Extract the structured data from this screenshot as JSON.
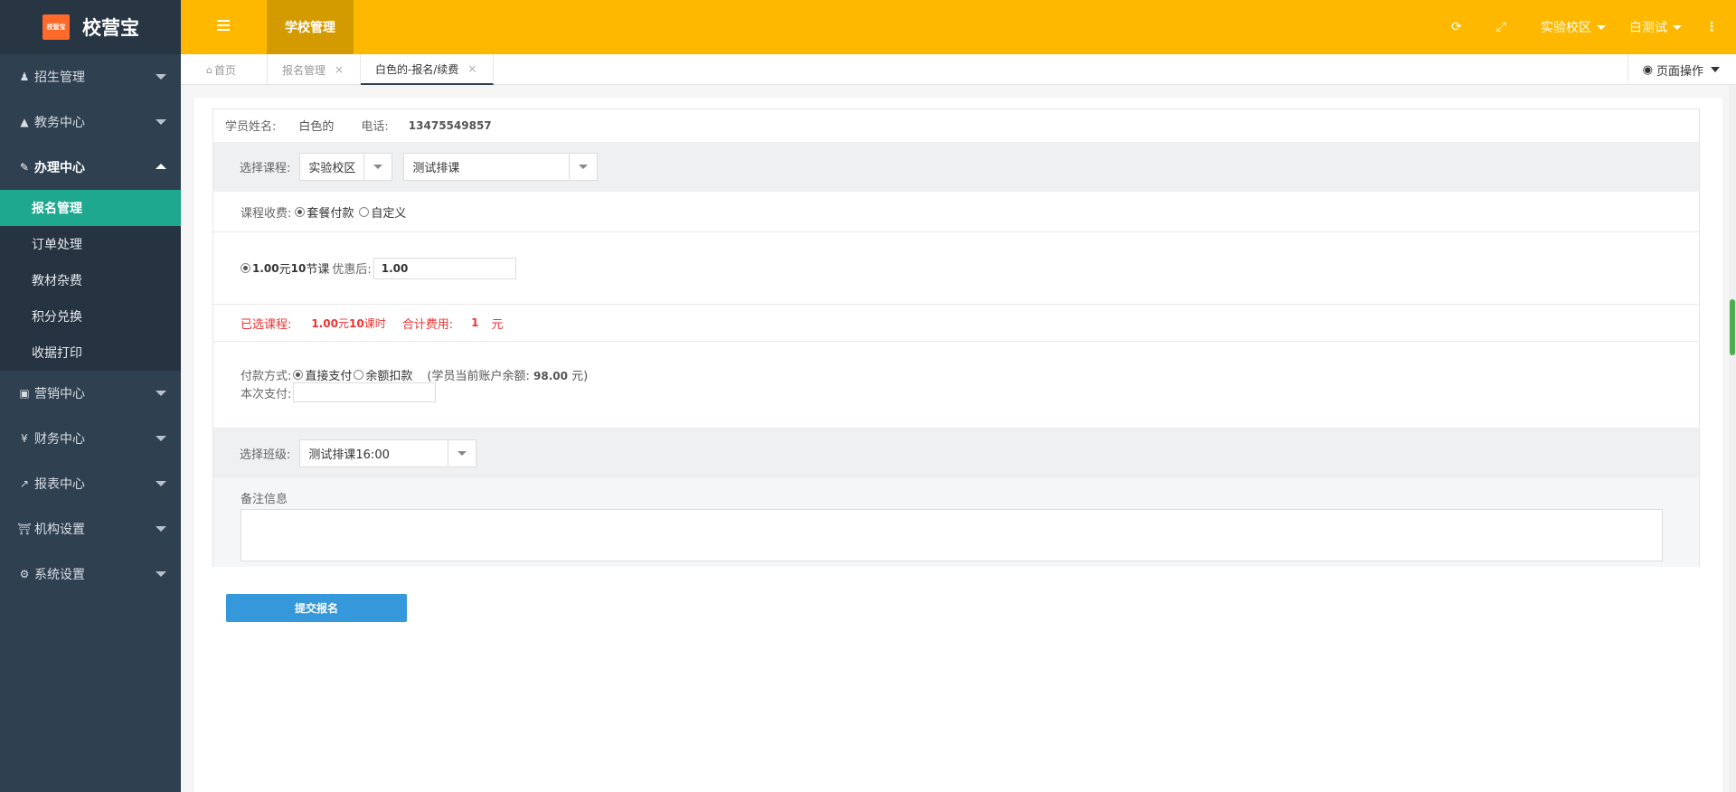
{
  "brand": {
    "logo_text": "校营宝",
    "name": "校营宝"
  },
  "sidebar": {
    "menus": [
      {
        "label": "招生管理",
        "icon": "user-icon"
      },
      {
        "label": "教务中心",
        "icon": "graduation-cap-icon"
      },
      {
        "label": "办理中心",
        "icon": "edit-icon"
      },
      {
        "label": "营销中心",
        "icon": "laptop-icon"
      },
      {
        "label": "财务中心",
        "icon": "yen-icon"
      },
      {
        "label": "报表中心",
        "icon": "line-chart-icon"
      },
      {
        "label": "机构设置",
        "icon": "institution-icon"
      },
      {
        "label": "系统设置",
        "icon": "cogs-icon"
      }
    ],
    "submenu": [
      "报名管理",
      "订单处理",
      "教材杂费",
      "积分兑换",
      "收据打印"
    ]
  },
  "topbar": {
    "module": "学校管理",
    "campus": "实验校区",
    "user": "白测试"
  },
  "tabs": {
    "home": "首页",
    "t1": "报名管理",
    "t2": "白色的-报名/续费",
    "page_ops": "页面操作"
  },
  "form": {
    "student_label": "学员姓名:",
    "student_name": "白色的",
    "phone_label": "电话:",
    "phone": "13475549857",
    "course_label": "选择课程:",
    "campus_select": "实验校区",
    "course_select": "测试排课",
    "fee_label": "课程收费:",
    "fee_opt1": "套餐付款",
    "fee_opt2": "自定义",
    "package_price": "1.00",
    "package_unit": "元",
    "package_count": "10",
    "package_suffix": "节课",
    "discount_label": "优惠后:",
    "discount_value": "1.00",
    "selected_label": "已选课程:",
    "selected_price": "1.00",
    "selected_unit": "元",
    "selected_count": "10",
    "selected_suffix": "课时",
    "total_label": "合计费用:",
    "total_value": "1",
    "total_unit": "元",
    "pay_label": "付款方式:",
    "pay_opt1": "直接支付",
    "pay_opt2": "余额扣款",
    "balance_prefix": "(学员当前账户余额:",
    "balance_value": "98.00",
    "balance_suffix": "元)",
    "this_pay_label": "本次支付:",
    "class_label": "选择班级:",
    "class_select": "测试排课16:00",
    "remark_label": "备注信息",
    "submit": "提交报名"
  }
}
